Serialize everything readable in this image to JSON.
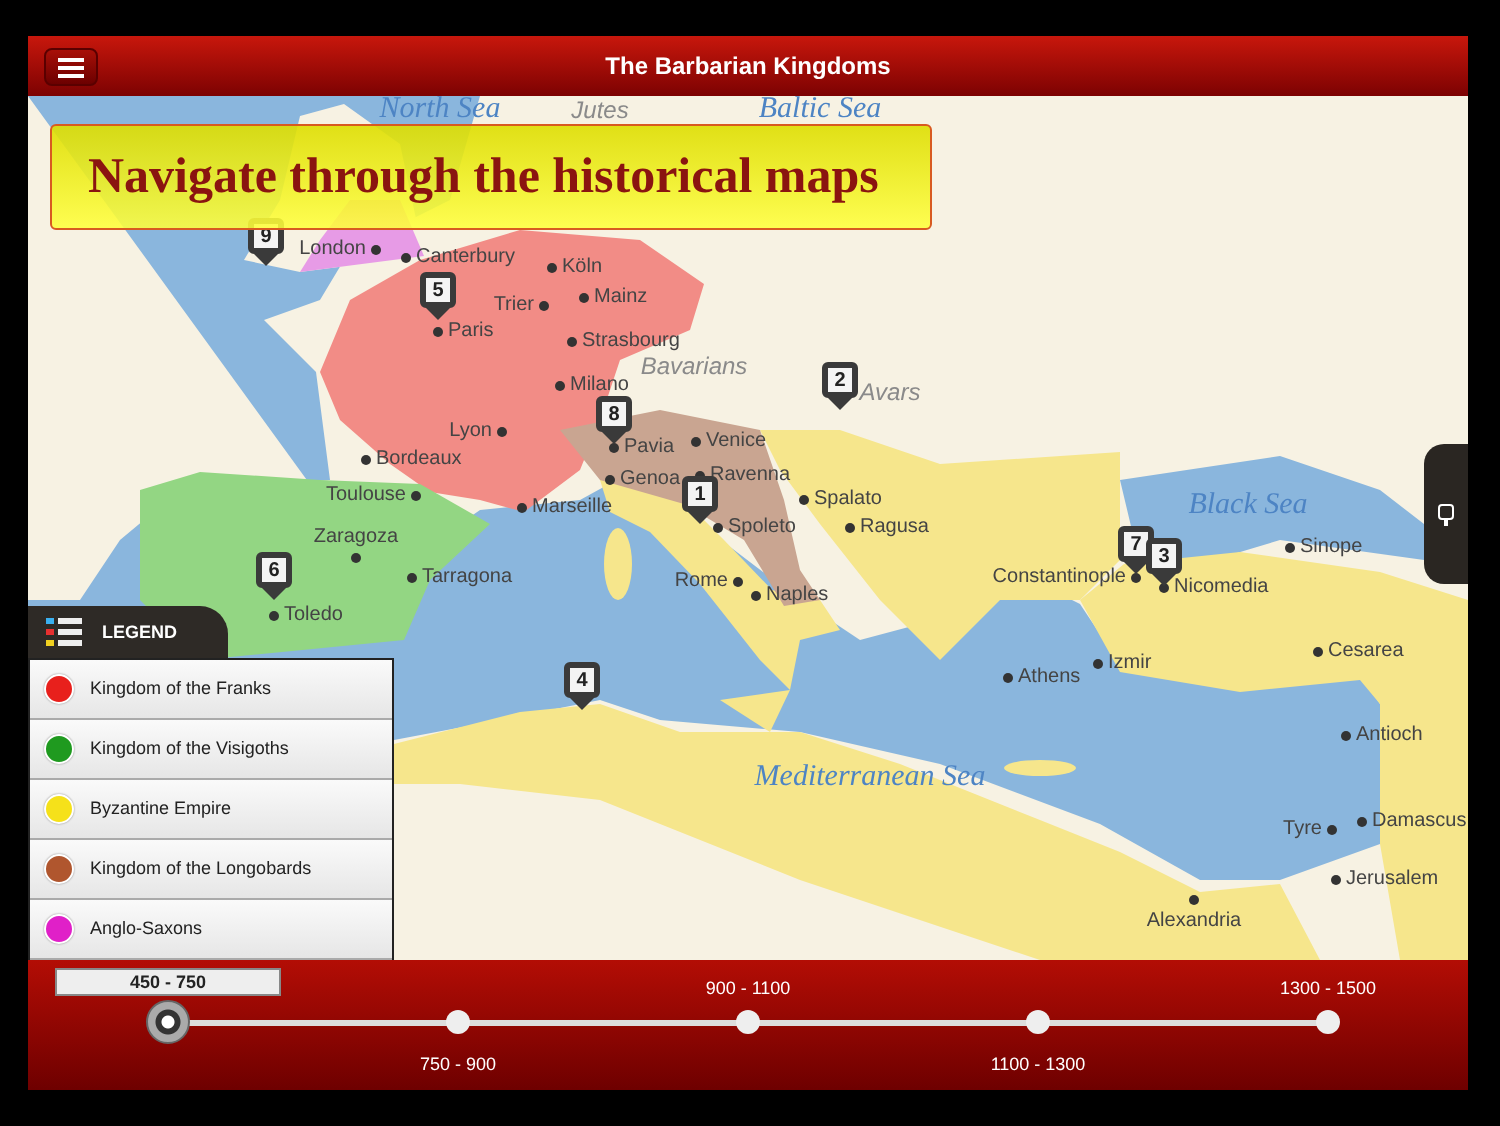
{
  "header": {
    "title": "The Barbarian Kingdoms"
  },
  "banner": {
    "text": "Navigate through the historical maps"
  },
  "map": {
    "region_labels": [
      {
        "text": "North Sea",
        "kind": "sea"
      },
      {
        "text": "Jutes",
        "kind": "people"
      },
      {
        "text": "Baltic Sea",
        "kind": "sea"
      },
      {
        "text": "Bavarians",
        "kind": "people"
      },
      {
        "text": "Avars",
        "kind": "people"
      },
      {
        "text": "Black Sea",
        "kind": "sea"
      },
      {
        "text": "Mediterranean Sea",
        "kind": "sea"
      }
    ],
    "cities": [
      {
        "name": "London"
      },
      {
        "name": "Canterbury"
      },
      {
        "name": "Köln"
      },
      {
        "name": "Mainz"
      },
      {
        "name": "Trier"
      },
      {
        "name": "Paris"
      },
      {
        "name": "Strasbourg"
      },
      {
        "name": "Lyon"
      },
      {
        "name": "Bordeaux"
      },
      {
        "name": "Toulouse"
      },
      {
        "name": "Marseille"
      },
      {
        "name": "Milano"
      },
      {
        "name": "Pavia"
      },
      {
        "name": "Genoa"
      },
      {
        "name": "Venice"
      },
      {
        "name": "Ravenna"
      },
      {
        "name": "Spoleto"
      },
      {
        "name": "Spalato"
      },
      {
        "name": "Ragusa"
      },
      {
        "name": "Rome"
      },
      {
        "name": "Naples"
      },
      {
        "name": "Zaragoza"
      },
      {
        "name": "Tarragona"
      },
      {
        "name": "Toledo"
      },
      {
        "name": "Constantinople"
      },
      {
        "name": "Nicomedia"
      },
      {
        "name": "Sinope"
      },
      {
        "name": "Izmir"
      },
      {
        "name": "Athens"
      },
      {
        "name": "Cesarea"
      },
      {
        "name": "Antioch"
      },
      {
        "name": "Tyre"
      },
      {
        "name": "Damascus"
      },
      {
        "name": "Jerusalem"
      },
      {
        "name": "Alexandria"
      }
    ],
    "markers": [
      {
        "number": "9"
      },
      {
        "number": "5"
      },
      {
        "number": "8"
      },
      {
        "number": "2"
      },
      {
        "number": "1"
      },
      {
        "number": "6"
      },
      {
        "number": "4"
      },
      {
        "number": "7"
      },
      {
        "number": "3"
      }
    ]
  },
  "legend": {
    "title": "LEGEND",
    "items": [
      {
        "label": "Kingdom of the Franks",
        "color": "#e8201c"
      },
      {
        "label": "Kingdom of the Visigoths",
        "color": "#1f9a1f"
      },
      {
        "label": "Byzantine Empire",
        "color": "#f5e11a"
      },
      {
        "label": "Kingdom of the Longobards",
        "color": "#b0562e"
      },
      {
        "label": "Anglo-Saxons",
        "color": "#e020c8"
      }
    ]
  },
  "timeline": {
    "periods": [
      {
        "label": "450 - 750",
        "selected": true
      },
      {
        "label": "750 - 900",
        "selected": false
      },
      {
        "label": "900 - 1100",
        "selected": false
      },
      {
        "label": "1100 - 1300",
        "selected": false
      },
      {
        "label": "1300 - 1500",
        "selected": false
      }
    ]
  }
}
